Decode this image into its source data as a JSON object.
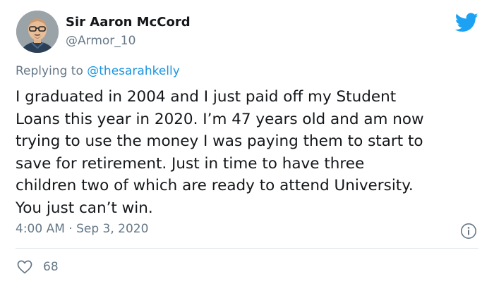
{
  "author": {
    "display_name": "Sir Aaron McCord",
    "handle": "@Armor_10",
    "avatar_icon": "bitmoji-avatar"
  },
  "reply": {
    "prefix": "Replying to",
    "mention": "@thesarahkelly"
  },
  "tweet": {
    "text": "I graduated in 2004 and I just paid off my Student\nLoans this year in 2020. I’m 47 years old and am now\ntrying to use the money I was paying them to start to\nsave for retirement. Just in time to have three\nchildren two of which are ready to attend University.\nYou just can’t win."
  },
  "meta": {
    "time": "4:00 AM",
    "separator": "·",
    "date": "Sep 3, 2020"
  },
  "actions": {
    "like_icon": "heart-icon",
    "like_count": "68"
  },
  "icons": {
    "brand": "twitter-bird-icon",
    "info": "info-icon"
  },
  "colors": {
    "brand_blue": "#1da1f2",
    "mention_blue": "#1b95e0",
    "secondary_text": "#657786",
    "primary_text": "#14171a",
    "divider": "#e1e8ed"
  }
}
